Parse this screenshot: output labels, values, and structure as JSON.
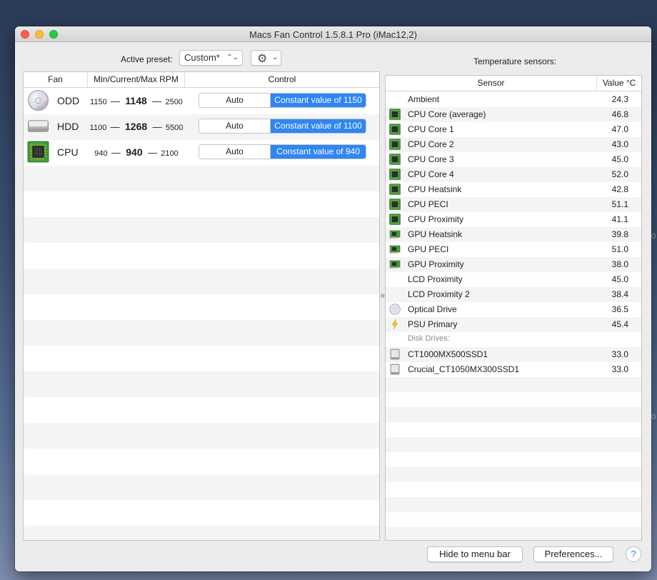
{
  "window": {
    "title": "Macs Fan Control 1.5.8.1 Pro (iMac12,2)"
  },
  "toolbar": {
    "preset_label": "Active preset:",
    "preset_value": "Custom*",
    "temp_sensors_label": "Temperature sensors:"
  },
  "fans": {
    "headers": {
      "fan": "Fan",
      "rpm": "Min/Current/Max RPM",
      "control": "Control"
    },
    "rows": [
      {
        "icon": "optical-drive-icon",
        "name": "ODD",
        "min": "1150",
        "current": "1148",
        "max": "2500",
        "auto_label": "Auto",
        "const_label": "Constant value of 1150"
      },
      {
        "icon": "hard-drive-icon",
        "name": "HDD",
        "min": "1100",
        "current": "1268",
        "max": "5500",
        "auto_label": "Auto",
        "const_label": "Constant value of 1100"
      },
      {
        "icon": "cpu-chip-icon",
        "name": "CPU",
        "min": "940",
        "current": "940",
        "max": "2100",
        "auto_label": "Auto",
        "const_label": "Constant value of 940"
      }
    ],
    "dash": "—"
  },
  "sensors": {
    "headers": {
      "sensor": "Sensor",
      "value": "Value °C"
    },
    "rows": [
      {
        "icon": "none",
        "name": "Ambient",
        "value": "24.3"
      },
      {
        "icon": "cpu",
        "name": "CPU Core (average)",
        "value": "46.8"
      },
      {
        "icon": "cpu",
        "name": "CPU Core 1",
        "value": "47.0"
      },
      {
        "icon": "cpu",
        "name": "CPU Core 2",
        "value": "43.0"
      },
      {
        "icon": "cpu",
        "name": "CPU Core 3",
        "value": "45.0"
      },
      {
        "icon": "cpu",
        "name": "CPU Core 4",
        "value": "52.0"
      },
      {
        "icon": "cpu",
        "name": "CPU Heatsink",
        "value": "42.8"
      },
      {
        "icon": "cpu",
        "name": "CPU PECI",
        "value": "51.1"
      },
      {
        "icon": "cpu",
        "name": "CPU Proximity",
        "value": "41.1"
      },
      {
        "icon": "gpu",
        "name": "GPU Heatsink",
        "value": "39.8"
      },
      {
        "icon": "gpu",
        "name": "GPU PECI",
        "value": "51.0"
      },
      {
        "icon": "gpu",
        "name": "GPU Proximity",
        "value": "38.0"
      },
      {
        "icon": "none",
        "name": "LCD Proximity",
        "value": "45.0"
      },
      {
        "icon": "none",
        "name": "LCD Proximity 2",
        "value": "38.4"
      },
      {
        "icon": "disc",
        "name": "Optical Drive",
        "value": "36.5"
      },
      {
        "icon": "bolt",
        "name": "PSU Primary",
        "value": "45.4"
      },
      {
        "icon": "subhead",
        "name": "Disk Drives:",
        "value": ""
      },
      {
        "icon": "ssd",
        "name": "CT1000MX500SSD1",
        "value": "33.0"
      },
      {
        "icon": "ssd",
        "name": "Crucial_CT1050MX300SSD1",
        "value": "33.0"
      }
    ]
  },
  "footer": {
    "hide_label": "Hide to menu bar",
    "prefs_label": "Preferences...",
    "help_label": "?"
  },
  "colors": {
    "accent": "#2f86f5",
    "chip_green": "#3f9a3c"
  }
}
